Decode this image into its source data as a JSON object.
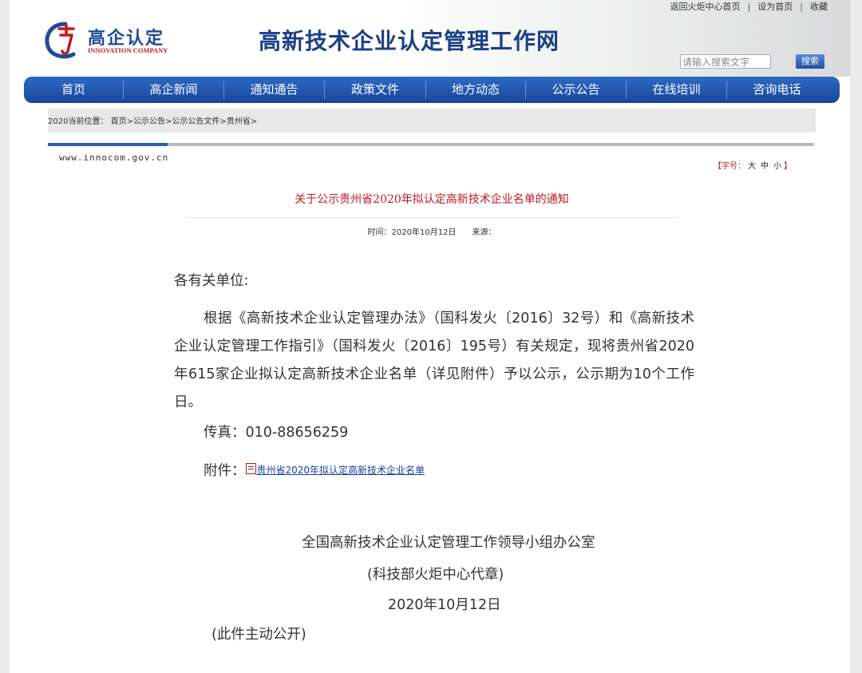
{
  "top_links": [
    "返回火炬中心首页",
    "设为首页",
    "收藏"
  ],
  "top_link_sep": "|",
  "logo": {
    "title": "高企认定",
    "subtitle": "INNOVATION COMPANY"
  },
  "site_title": "高新技术企业认定管理工作网",
  "search": {
    "placeholder": "请输入搜索文字",
    "button": "搜索"
  },
  "nav": [
    "首页",
    "高企新闻",
    "通知通告",
    "政策文件",
    "地方动态",
    "公示公告",
    "在线培训",
    "咨询电话"
  ],
  "breadcrumb": "2020当前位置： 首页>公示公告>公示公告文件>贵州省>",
  "domain_text": "www.innocom.gov.cn",
  "font_size": {
    "label": "【字号：",
    "options": [
      "大",
      "中",
      "小"
    ],
    "end": "】"
  },
  "article": {
    "title": "关于公示贵州省2020年拟认定高新技术企业名单的通知",
    "time": "时间：2020年10月12日",
    "source": "来源：",
    "salutation": "各有关单位:",
    "paragraph": "根据《高新技术企业认定管理办法》（国科发火〔2016〕32号）和《高新技术企业认定管理工作指引》（国科发火〔2016〕195号）有关规定，现将贵州省2020年615家企业拟认定高新技术企业名单（详见附件）予以公示，公示期为10个工作日。",
    "fax": "传真：010-88656259",
    "attachment_label": "附件：",
    "attachment_link": "贵州省2020年拟认定高新技术企业名单",
    "signature_org": "全国高新技术企业认定管理工作领导小组办公室",
    "signature_seal": "(科技部火炬中心代章)",
    "signature_date": "2020年10月12日",
    "disclosure": "(此件主动公开)"
  },
  "colors": {
    "nav_blue": "#2f69c4",
    "title_red": "#c0181e",
    "brand_blue": "#1c3f86",
    "logo_red": "#c0191f"
  }
}
